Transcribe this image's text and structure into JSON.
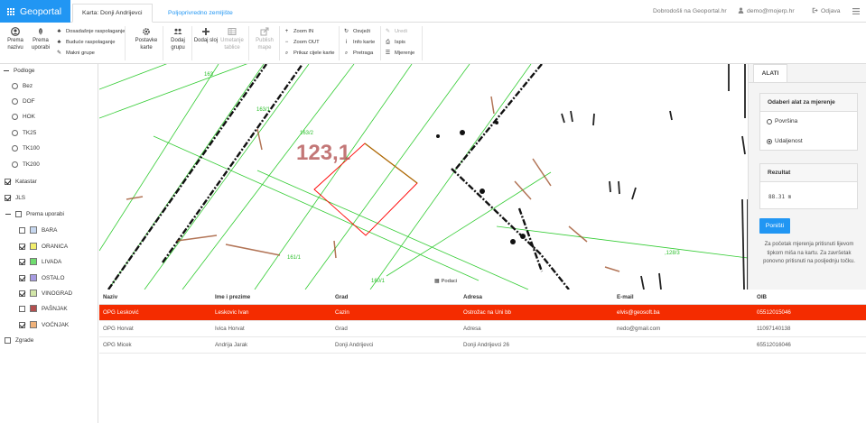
{
  "app": {
    "brand": "Geoportal"
  },
  "tabs": [
    {
      "label": "Karta: Donji Andrijevci",
      "active": true
    },
    {
      "label": "Poljoprivredno zemljište",
      "active": false
    }
  ],
  "header": {
    "welcome": "Dobrodošli na Geoportal.hr",
    "user": "demo@mojerp.hr",
    "logout": "Odjava"
  },
  "toolbar": {
    "prema_nazivu": "Prema nazivu",
    "prema_uporabi": "Prema uporabi",
    "dosadasnje": "Dosadašnje raspolaganje",
    "buduce": "Buduće raspolaganje",
    "makni": "Makni grupe",
    "postavke": "Postavke karte",
    "dodaj_grupu": "Dodaj grupu",
    "dodaj_sloj": "Dodaj sloj",
    "umetanje": "Umetanje tablice",
    "publish": "Publish mape",
    "zoom_in": "Zoom IN",
    "zoom_out": "Zoom OUT",
    "prikaz": "Prikaz cijele karte",
    "osvjezi": "Osvježi",
    "info": "Info karte",
    "pretraga": "Pretraga",
    "uredi": "Uredi",
    "ispis": "Ispis",
    "mjerenje": "Mjerenje"
  },
  "sidebar": {
    "podloge": "Podloge",
    "radios": [
      "Bez",
      "DOF",
      "HOK",
      "TK25",
      "TK100",
      "TK200"
    ],
    "katastar": "Katastar",
    "jls": "JLS",
    "prema_uporabi": "Prema uporabi",
    "uporabe": [
      {
        "label": "BARA",
        "color": "#c6d7ef",
        "checked": false
      },
      {
        "label": "ORANICA",
        "color": "#f2ee6c",
        "checked": true
      },
      {
        "label": "LIVADA",
        "color": "#6fdc6f",
        "checked": true
      },
      {
        "label": "OSTALO",
        "color": "#a79be2",
        "checked": true
      },
      {
        "label": "VINOGRAD",
        "color": "#d2e6a8",
        "checked": true
      },
      {
        "label": "PAŠNJAK",
        "color": "#b24f4f",
        "checked": false
      },
      {
        "label": "VOĆNJAK",
        "color": "#f0b27a",
        "checked": true
      }
    ],
    "zgrade": "Zgrade"
  },
  "map": {
    "parcel_big": "123,1",
    "labels": [
      "163",
      "163/1",
      "163/2",
      "161/1",
      "160/1",
      ",128/3"
    ],
    "podaci": "Podaci"
  },
  "tools": {
    "tab": "ALATI",
    "measure_title": "Odaberi alat za mjerenje",
    "povrsina": "Površina",
    "udaljenost": "Udaljenost",
    "result_title": "Rezultat",
    "result_value": "88.31 m",
    "reset": "Poništi",
    "hint": "Za početak mjerenja pritisnuti lijevom tipkom miša na kartu. Za završetak ponovno pritisnuti na posljednju točku."
  },
  "table": {
    "headers": [
      "Naziv",
      "Ime i prezime",
      "Grad",
      "Adresa",
      "E-mail",
      "OIB"
    ],
    "rows": [
      [
        "OPG Lesković",
        "Leskovic Ivan",
        "Cazin",
        "Ostrožac na Uni bb",
        "elvis@geosoft.ba",
        "05512015046"
      ],
      [
        "OPG Horvat",
        "Ivica Horvat",
        "Grad",
        "Adresa",
        "nedo@gmail.com",
        "11097140138"
      ],
      [
        "OPG Micek",
        "Andrija Jarak",
        "Donji Andrijevci",
        "Donji Andrijevci 26",
        "",
        "65512016046"
      ]
    ]
  },
  "colors": {
    "accent": "#2196f3",
    "selected_row": "#f42c00",
    "parcel_line": "#2ecc40"
  }
}
